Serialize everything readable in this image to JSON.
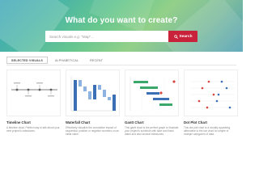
{
  "hero": {
    "title": "What do you want to create?",
    "search_placeholder": "Search visuals e.g. \"Map\"...",
    "search_button": "Search"
  },
  "tabs": [
    {
      "label": "Selected Visuals",
      "active": true
    },
    {
      "label": "Alphabetical",
      "active": false
    },
    {
      "label": "Recent",
      "active": false
    }
  ],
  "cards": [
    {
      "title": "Timeline Chart",
      "description": "A timeline chart. Perfect way to talk about your next project's milestones.",
      "icon": "timeline-chart-icon"
    },
    {
      "title": "Waterfall Chart",
      "description": "Effectively visualize the cumulative impact of sequential, positive or negative numbers on an initial value.",
      "icon": "waterfall-chart-icon"
    },
    {
      "title": "Gantt Chart",
      "description": "This gantt chart is the perfect graph to illustrate your project's schedule with start and finish dates and also several milestones.",
      "icon": "gantt-chart-icon"
    },
    {
      "title": "Dot Plot Chart",
      "description": "This dot plot chart is a visually appealing alternative to the bar chart for simple or multiple categories of data.",
      "icon": "dot-plot-chart-icon"
    }
  ],
  "colors": {
    "accent_red": "#c9233b",
    "hero_teal": "#3aa5b8",
    "hero_green": "#93d08a",
    "thumb_blue": "#3b6fb6",
    "thumb_light_blue": "#8fb3e0",
    "thumb_green": "#3aa86a",
    "thumb_red": "#d6453d",
    "thumb_gray": "#b5b5b5"
  }
}
